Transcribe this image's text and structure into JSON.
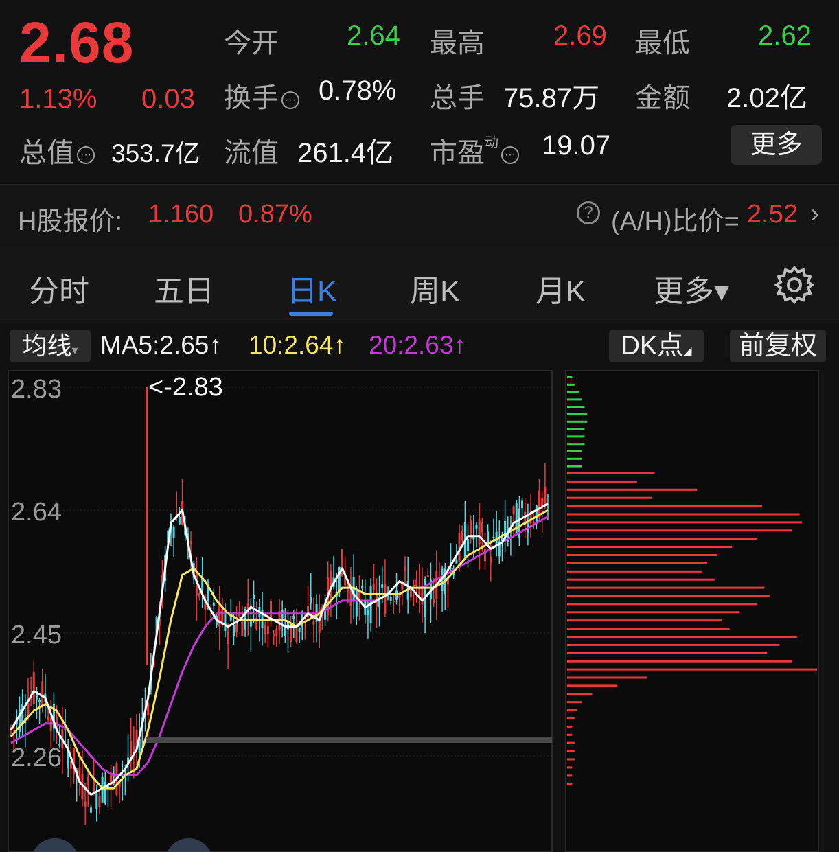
{
  "quote": {
    "price": "2.68",
    "change_pct": "1.13%",
    "change": "0.03",
    "open_label": "今开",
    "open": "2.64",
    "high_label": "最高",
    "high": "2.69",
    "low_label": "最低",
    "low": "2.62",
    "turnover_label": "换手",
    "turnover": "0.78%",
    "volume_label": "总手",
    "volume": "75.87万",
    "amount_label": "金额",
    "amount": "2.02亿",
    "mcap_label": "总值",
    "mcap": "353.7亿",
    "float_label": "流值",
    "float_cap": "261.4亿",
    "pe_label": "市盈",
    "pe_sup": "动",
    "pe": "19.07",
    "more_label": "更多",
    "info_icon": "info-dots-icon"
  },
  "hshare": {
    "label": "H股报价:",
    "price": "1.160",
    "change_pct": "0.87%",
    "ratio_label": "(A/H)比价=",
    "ratio": "2.52"
  },
  "tabs": [
    {
      "label": "分时"
    },
    {
      "label": "五日"
    },
    {
      "label": "日K",
      "active": true
    },
    {
      "label": "周K"
    },
    {
      "label": "月K"
    },
    {
      "label": "更多▾"
    }
  ],
  "ma": {
    "selector": "均线",
    "ma5": "MA5:2.65",
    "ma10": "10:2.64",
    "ma20": "20:2.63",
    "dk_label": "DK点",
    "fq_label": "前复权"
  },
  "colors": {
    "up": "#e83a3a",
    "down": "#3ad14a",
    "ma5": "#ffffff",
    "ma10": "#f5e663",
    "ma20": "#c43ad6",
    "down_candle": "#4fd9e6"
  },
  "chart_data": {
    "type": "candlestick",
    "yaxis_ticks": [
      "2.83",
      "2.64",
      "2.45",
      "2.26"
    ],
    "high_marker": "<-2.83",
    "ylim": [
      2.2,
      2.85
    ],
    "ma5_series": [
      2.3,
      2.33,
      2.36,
      2.35,
      2.3,
      2.27,
      2.22,
      2.2,
      2.21,
      2.22,
      2.24,
      2.27,
      2.35,
      2.48,
      2.62,
      2.64,
      2.54,
      2.5,
      2.47,
      2.46,
      2.47,
      2.49,
      2.48,
      2.47,
      2.46,
      2.46,
      2.48,
      2.47,
      2.52,
      2.55,
      2.51,
      2.49,
      2.5,
      2.51,
      2.53,
      2.52,
      2.5,
      2.52,
      2.54,
      2.57,
      2.6,
      2.6,
      2.58,
      2.59,
      2.62,
      2.63,
      2.64,
      2.65
    ],
    "ma10_series": [
      2.29,
      2.31,
      2.33,
      2.34,
      2.33,
      2.3,
      2.26,
      2.23,
      2.21,
      2.21,
      2.23,
      2.24,
      2.3,
      2.38,
      2.47,
      2.54,
      2.55,
      2.53,
      2.5,
      2.48,
      2.47,
      2.47,
      2.47,
      2.47,
      2.47,
      2.46,
      2.47,
      2.48,
      2.5,
      2.52,
      2.52,
      2.51,
      2.51,
      2.51,
      2.51,
      2.52,
      2.52,
      2.52,
      2.53,
      2.55,
      2.57,
      2.58,
      2.59,
      2.6,
      2.61,
      2.62,
      2.63,
      2.64
    ],
    "ma20_series": [
      2.28,
      2.29,
      2.3,
      2.31,
      2.31,
      2.3,
      2.28,
      2.26,
      2.24,
      2.23,
      2.23,
      2.23,
      2.25,
      2.29,
      2.34,
      2.39,
      2.43,
      2.46,
      2.48,
      2.48,
      2.48,
      2.48,
      2.48,
      2.48,
      2.48,
      2.48,
      2.48,
      2.48,
      2.49,
      2.5,
      2.5,
      2.5,
      2.5,
      2.51,
      2.51,
      2.52,
      2.52,
      2.53,
      2.54,
      2.55,
      2.56,
      2.57,
      2.58,
      2.59,
      2.6,
      2.61,
      2.62,
      2.63
    ],
    "volume_profile_up": [
      0.35,
      0.28,
      0.52,
      0.34,
      0.78,
      0.93,
      0.94,
      0.9,
      0.76,
      0.66,
      0.6,
      0.56,
      0.54,
      0.59,
      0.79,
      0.81,
      0.76,
      0.69,
      0.62,
      0.65,
      0.92,
      0.85,
      0.8,
      0.9,
      1.0,
      0.32,
      0.2,
      0.1,
      0.06,
      0.04,
      0.03,
      0.02,
      0.02,
      0.03,
      0.03,
      0.03,
      0.02,
      0.02,
      0.02
    ],
    "volume_profile_down": [
      0.02,
      0.03,
      0.05,
      0.06,
      0.07,
      0.08,
      0.08,
      0.07,
      0.07,
      0.07,
      0.06,
      0.06,
      0.06
    ]
  }
}
